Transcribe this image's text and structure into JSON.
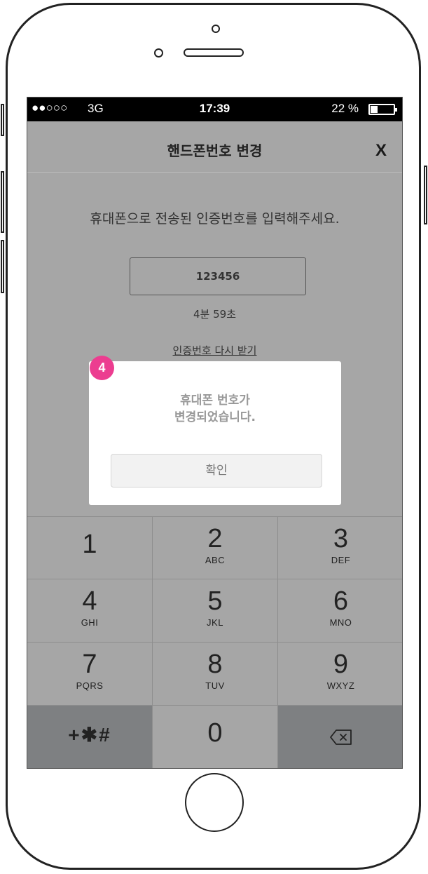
{
  "status_bar": {
    "signal": "●●○○○",
    "network": "3G",
    "time": "17:39",
    "battery_percent": "22 %",
    "battery_level": 0.22
  },
  "header": {
    "title": "핸드폰번호 변경",
    "close_label": "X"
  },
  "verification": {
    "instruction": "휴대폰으로 전송된 인증번호를 입력해주세요.",
    "code_value": "123456",
    "timer": "4분 59초",
    "resend_link": "인증번호 다시 받기"
  },
  "dialog": {
    "message_line1": "휴대폰 번호가",
    "message_line2": "변경되었습니다.",
    "confirm_label": "확인"
  },
  "annotation_badge": "4",
  "keypad": {
    "keys": [
      {
        "digit": "1",
        "letters": ""
      },
      {
        "digit": "2",
        "letters": "ABC"
      },
      {
        "digit": "3",
        "letters": "DEF"
      },
      {
        "digit": "4",
        "letters": "GHI"
      },
      {
        "digit": "5",
        "letters": "JKL"
      },
      {
        "digit": "6",
        "letters": "MNO"
      },
      {
        "digit": "7",
        "letters": "PQRS"
      },
      {
        "digit": "8",
        "letters": "TUV"
      },
      {
        "digit": "9",
        "letters": "WXYZ"
      }
    ],
    "symbols_label": "+✱#",
    "zero": "0",
    "backspace_icon": "backspace-icon"
  },
  "colors": {
    "overlay_gray": "#a6a6a6",
    "badge_pink": "#ec3d90",
    "dark_key": "#7e8082"
  }
}
